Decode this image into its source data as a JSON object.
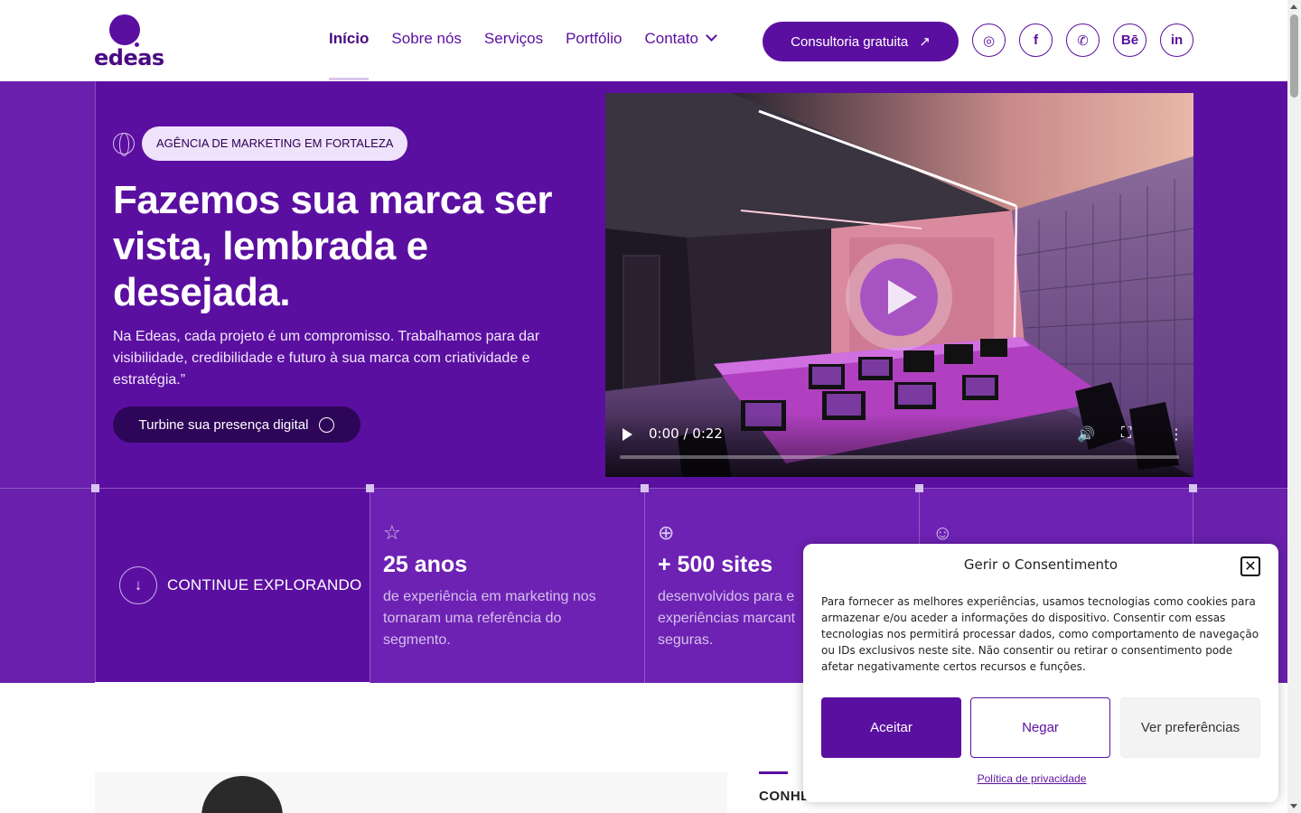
{
  "brand": {
    "logo_text": "edeas",
    "primary_color": "#5b0fa0",
    "dark_color": "#2e0659"
  },
  "nav": {
    "items": [
      {
        "label": "Início"
      },
      {
        "label": "Sobre nós"
      },
      {
        "label": "Serviços"
      },
      {
        "label": "Portfólio"
      },
      {
        "label": "Contato"
      }
    ],
    "cta_label": "Consultoria gratuita",
    "cta_icon": "arrow-up-right-icon",
    "socials": [
      {
        "name": "instagram-icon",
        "glyph": "◎"
      },
      {
        "name": "facebook-icon",
        "glyph": "f"
      },
      {
        "name": "whatsapp-icon",
        "glyph": "✆"
      },
      {
        "name": "behance-icon",
        "glyph": "Bē"
      },
      {
        "name": "linkedin-icon",
        "glyph": "in"
      }
    ]
  },
  "hero": {
    "badge": "AGÊNCIA DE MARKETING EM FORTALEZA",
    "title": "Fazemos sua marca ser vista, lembrada e desejada.",
    "subtitle": "Na Edeas, cada projeto é um compromisso. Trabalhamos para dar visibilidade, credibilidade e futuro à sua marca com criatividade e estratégia.”",
    "button_label": "Turbine sua presença digital"
  },
  "video": {
    "time": "0:00 / 0:22",
    "progress": 0
  },
  "stats": {
    "explore_label": "CONTINUE EXPLORANDO",
    "items": [
      {
        "icon": "star-icon",
        "glyph": "☆",
        "number": "25 anos",
        "desc": "de experiência em marketing nos tornaram uma referência do segmento."
      },
      {
        "icon": "globe-icon",
        "glyph": "⊕",
        "number": "+ 500 sites",
        "desc": "desenvolvidos para e experiências marcant seguras."
      },
      {
        "icon": "smile-icon",
        "glyph": "☺",
        "number": "",
        "desc": ""
      }
    ]
  },
  "below": {
    "section_label": "CONHE"
  },
  "consent": {
    "title": "Gerir o Consentimento",
    "text": "Para fornecer as melhores experiências, usamos tecnologias como cookies para armazenar e/ou aceder a informações do dispositivo. Consentir com essas tecnologias nos permitirá processar dados, como comportamento de navegação ou IDs exclusivos neste site. Não consentir ou retirar o consentimento pode afetar negativamente certos recursos e funções.",
    "accept": "Aceitar",
    "deny": "Negar",
    "prefs": "Ver preferências",
    "privacy_link": "Política de privacidade"
  }
}
